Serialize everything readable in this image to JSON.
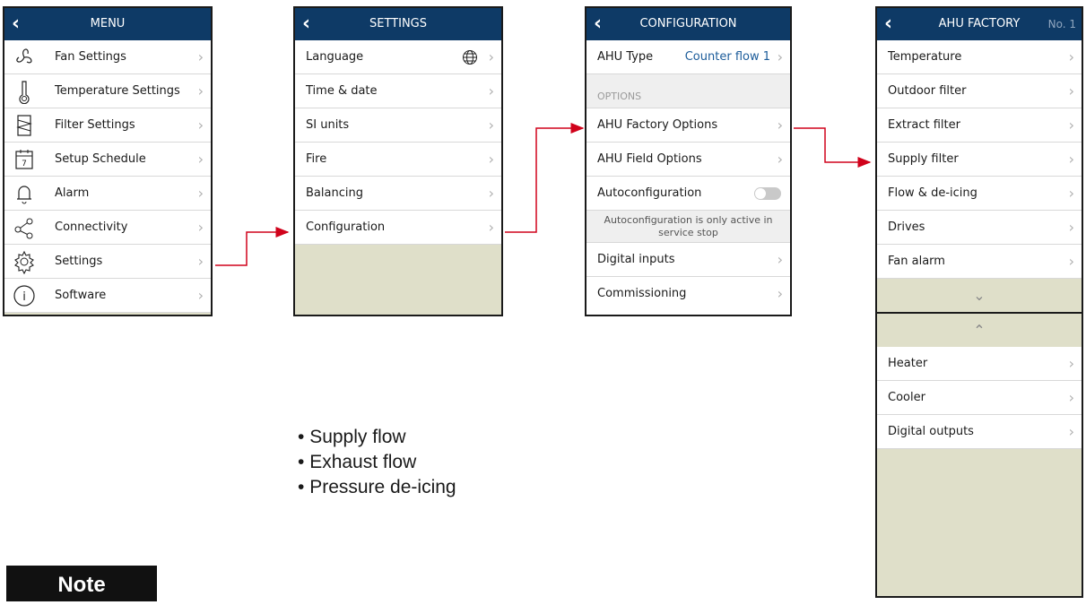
{
  "menu": {
    "title": "MENU",
    "items": [
      {
        "label": "Fan Settings",
        "icon": "fan-icon"
      },
      {
        "label": "Temperature Settings",
        "icon": "thermometer-icon"
      },
      {
        "label": "Filter Settings",
        "icon": "filter-icon"
      },
      {
        "label": "Setup Schedule",
        "icon": "calendar-icon",
        "icon_text": "7"
      },
      {
        "label": "Alarm",
        "icon": "bell-icon"
      },
      {
        "label": "Connectivity",
        "icon": "share-icon"
      },
      {
        "label": "Settings",
        "icon": "gear-icon"
      },
      {
        "label": "Software",
        "icon": "info-icon",
        "icon_text": "i"
      }
    ]
  },
  "settings": {
    "title": "SETTINGS",
    "items": [
      "Language",
      "Time & date",
      "SI units",
      "Fire",
      "Balancing",
      "Configuration"
    ]
  },
  "configuration": {
    "title": "CONFIGURATION",
    "ahu_type_label": "AHU Type",
    "ahu_type_value": "Counter flow 1",
    "options_header": "OPTIONS",
    "factory_options": "AHU Factory Options",
    "field_options": "AHU Field Options",
    "autoconfig": "Autoconfiguration",
    "autoconfig_note": "Autoconfiguration is only active in service stop",
    "digital_inputs": "Digital inputs",
    "commissioning": "Commissioning"
  },
  "factory": {
    "title": "AHU FACTORY",
    "number": "No. 1",
    "items_top": [
      "Temperature",
      "Outdoor filter",
      "Extract filter",
      "Supply filter",
      "Flow & de-icing",
      "Drives",
      "Fan alarm"
    ],
    "items_bottom": [
      "Heater",
      "Cooler",
      "Digital outputs"
    ]
  },
  "bullets": [
    "Supply flow",
    "Exhaust flow",
    "Pressure de-icing"
  ],
  "note_label": "Note",
  "colors": {
    "header": "#0e3a66",
    "arrow": "#d0021b",
    "filler": "#dfdfc9"
  }
}
